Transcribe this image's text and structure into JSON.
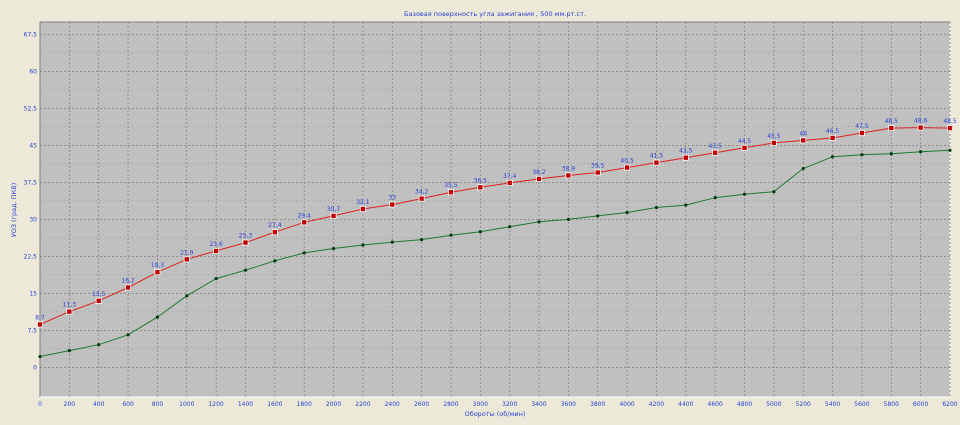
{
  "chart_data": {
    "type": "line",
    "title": "Базовая поверхность угла зажигания , 500 мм.рт.ст.",
    "xlabel": "Обороты (об/мин)",
    "ylabel": "УОЗ (град. ПКВ)",
    "xlim": [
      0,
      6200
    ],
    "ylim": [
      -6,
      70
    ],
    "x_ticks": [
      0,
      200,
      400,
      600,
      800,
      1000,
      1200,
      1400,
      1600,
      1800,
      2000,
      2200,
      2400,
      2600,
      2800,
      3000,
      3200,
      3400,
      3600,
      3800,
      4000,
      4200,
      4400,
      4600,
      4800,
      5000,
      5200,
      5400,
      5600,
      5800,
      6000,
      6200
    ],
    "y_ticks": [
      0,
      7.5,
      15,
      22.5,
      30,
      37.5,
      45,
      52.5,
      60,
      67.5
    ],
    "y_tick_labels": [
      "0",
      "7,5",
      "15",
      "22,5",
      "30",
      "37,5",
      "45",
      "52,5",
      "60",
      "67,5"
    ],
    "grid": true,
    "series": [
      {
        "color": "#e02020",
        "marker": "square",
        "x": [
          0,
          200,
          400,
          600,
          800,
          1000,
          1200,
          1400,
          1600,
          1800,
          2000,
          2200,
          2400,
          2600,
          2800,
          3000,
          3200,
          3400,
          3600,
          3800,
          4000,
          4200,
          4400,
          4600,
          4800,
          5000,
          5200,
          5400,
          5600,
          5800,
          6000,
          6200
        ],
        "values": [
          8.7,
          11.3,
          13.5,
          16.2,
          19.3,
          21.9,
          23.6,
          25.3,
          27.4,
          29.4,
          30.7,
          32.1,
          33,
          34.2,
          35.5,
          36.5,
          37.4,
          38.2,
          38.9,
          39.5,
          40.5,
          41.5,
          42.5,
          43.5,
          44.5,
          45.5,
          46,
          46.5,
          47.5,
          48.5,
          48.6,
          48.5
        ],
        "labels": [
          "8,7",
          "11,3",
          "13,5",
          "16,2",
          "19,3",
          "21,9",
          "23,6",
          "25,3",
          "27,4",
          "29,4",
          "30,7",
          "32,1",
          "33",
          "34,2",
          "35,5",
          "36,5",
          "37,4",
          "38,2",
          "38,9",
          "39,5",
          "40,5",
          "41,5",
          "42,5",
          "43,5",
          "44,5",
          "45,5",
          "46",
          "46,5",
          "47,5",
          "48,5",
          "48,6",
          "48,5"
        ]
      },
      {
        "color": "#1e7a32",
        "marker": "dot",
        "x": [
          0,
          200,
          400,
          600,
          800,
          1000,
          1200,
          1400,
          1600,
          1800,
          2000,
          2200,
          2400,
          2600,
          2800,
          3000,
          3200,
          3400,
          3600,
          3800,
          4000,
          4200,
          4400,
          4600,
          4800,
          5000,
          5200,
          5400,
          5600,
          5800,
          6000,
          6200
        ],
        "values": [
          2.2,
          3.4,
          4.6,
          6.6,
          10.2,
          14.5,
          18.0,
          19.7,
          21.6,
          23.2,
          24.1,
          24.8,
          25.4,
          25.9,
          26.8,
          27.5,
          28.5,
          29.5,
          30.0,
          30.7,
          31.4,
          32.4,
          32.9,
          34.4,
          35.1,
          35.6,
          40.3,
          42.7,
          43.1,
          43.3,
          43.7,
          44.0
        ]
      }
    ]
  },
  "colors": {
    "window_bg": "#ece9d8",
    "plot_bg": "#c0c0c0",
    "grid": "#7f7f7f",
    "title": "#2b3fd6",
    "tick_label": "#2b3fd6",
    "data_label": "#2b3fd6"
  }
}
